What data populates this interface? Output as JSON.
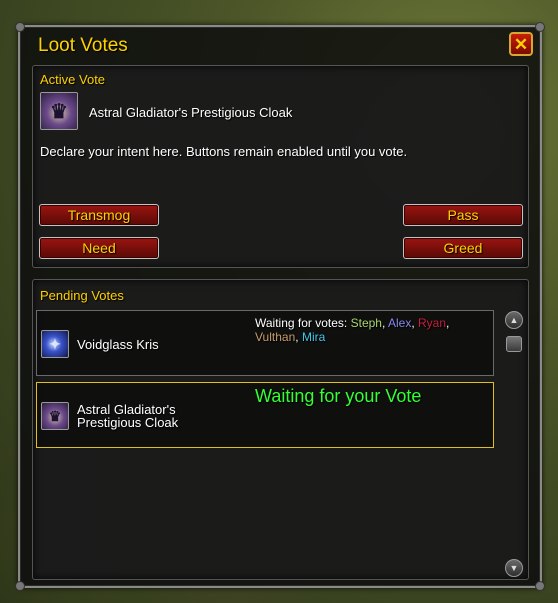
{
  "window": {
    "title": "Loot Votes",
    "close_glyph": "✕"
  },
  "active_vote": {
    "section_label": "Active Vote",
    "item_name": "Astral Gladiator's Prestigious Cloak",
    "item_icon": "cloak-icon",
    "instruction": "Declare your intent here. Buttons remain enabled until you vote.",
    "buttons": {
      "transmog": "Transmog",
      "pass": "Pass",
      "need": "Need",
      "greed": "Greed"
    }
  },
  "pending_votes": {
    "section_label": "Pending Votes",
    "rows": [
      {
        "item_name": "Voidglass Kris",
        "item_icon": "dagger-icon",
        "status_prefix": "Waiting for votes:",
        "voters": [
          {
            "name": "Steph",
            "color": "#abd473"
          },
          {
            "name": "Alex",
            "color": "#8787ed"
          },
          {
            "name": "Ryan",
            "color": "#c41f3b"
          },
          {
            "name": "Vulthan",
            "color": "#c79c6e"
          },
          {
            "name": "Mira",
            "color": "#40c7eb"
          }
        ]
      },
      {
        "item_name_line1": "Astral Gladiator's",
        "item_name_line2": "Prestigious Cloak",
        "item_icon": "cloak-icon",
        "status": "Waiting for your Vote"
      }
    ]
  },
  "colors": {
    "title_gold": "#ffd100",
    "button_red": "#9a1410",
    "status_green": "#33ff33",
    "selected_border": "#e0c020"
  }
}
